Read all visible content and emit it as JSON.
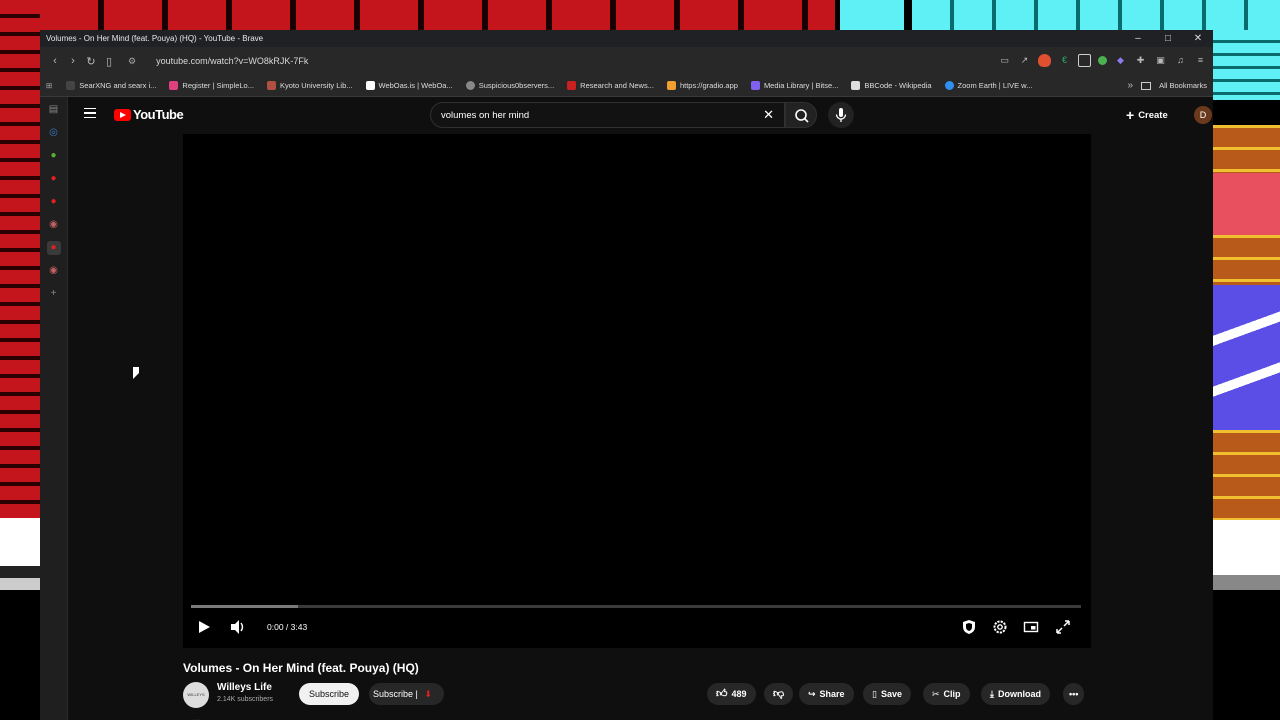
{
  "window": {
    "title": "Volumes - On Her Mind (feat. Pouya) (HQ) - YouTube - Brave",
    "controls": [
      "–",
      "□",
      "✕"
    ]
  },
  "address_bar": {
    "url": "youtube.com/watch?v=WO8kRJK-7Fk"
  },
  "bookmarks": {
    "items": [
      {
        "label": "SearXNG and searx i...",
        "color": "#444444"
      },
      {
        "label": "Register | SimpleLo...",
        "color": "#e04080"
      },
      {
        "label": "Kyoto University Lib...",
        "color": "#b05040"
      },
      {
        "label": "WebOas.is | WebOa...",
        "color": "#ffffff"
      },
      {
        "label": "Suspicious0bservers...",
        "color": "#888888"
      },
      {
        "label": "Research and News...",
        "color": "#cc2020"
      },
      {
        "label": "https://gradio.app",
        "color": "#f0a030"
      },
      {
        "label": "Media Library | Bitse...",
        "color": "#8060f0"
      },
      {
        "label": "BBCode - Wikipedia",
        "color": "#dddddd"
      },
      {
        "label": "Zoom Earth | LIVE w...",
        "color": "#3090f0"
      }
    ],
    "more": "»",
    "all_bookmarks": "All Bookmarks"
  },
  "youtube": {
    "logo_text": "YouTube",
    "search": {
      "value": "volumes on her mind"
    },
    "create_label": "Create",
    "avatar_letter": "D"
  },
  "player": {
    "time": "0:00 / 3:43",
    "buffered_fraction": 0.12
  },
  "video": {
    "title": "Volumes - On Her Mind (feat. Pouya) (HQ)",
    "channel_name": "Willeys Life",
    "channel_avatar_text": "WILLEYS LIFE",
    "subscribers": "2.14K subscribers",
    "subscribe_label": "Subscribe",
    "subscribe2_label": "Subscribe |",
    "likes": "489",
    "share_label": "Share",
    "save_label": "Save",
    "clip_label": "Clip",
    "download_label": "Download"
  },
  "colors": {
    "yt_red": "#ff0000",
    "bg": "#0f0f0f"
  }
}
